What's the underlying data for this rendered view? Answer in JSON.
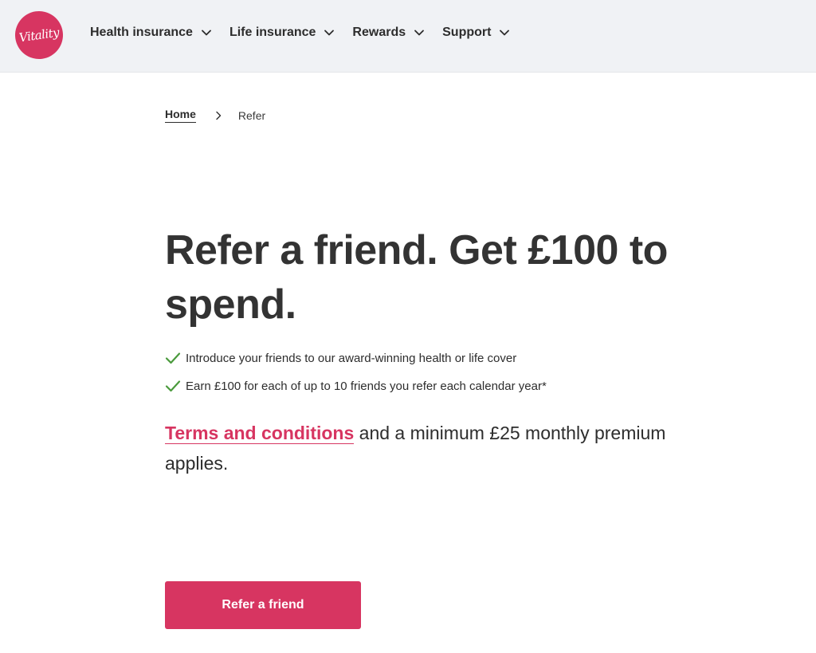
{
  "header": {
    "logo_text": "Vitality",
    "nav": [
      {
        "label": "Health insurance",
        "icon": "chevron-down-icon"
      },
      {
        "label": "Life insurance",
        "icon": "chevron-down-icon"
      },
      {
        "label": "Rewards",
        "icon": "chevron-down-icon"
      },
      {
        "label": "Support",
        "icon": "chevron-down-icon"
      }
    ]
  },
  "breadcrumb": {
    "home": "Home",
    "current": "Refer"
  },
  "hero": {
    "title": "Refer a friend. Get £100 to spend.",
    "bullets": [
      "Introduce your friends to our award-winning health or life cover",
      "Earn £100 for each of up to 10 friends you refer each calendar year*"
    ],
    "terms_link": "Terms and conditions",
    "terms_rest": " and a minimum £25 monthly premium applies.",
    "cta_label": "Refer a friend"
  },
  "colors": {
    "brand": "#d73561",
    "check": "#4a9a3c",
    "header_bg": "#f0f2f5",
    "text": "#2d2d2d"
  }
}
